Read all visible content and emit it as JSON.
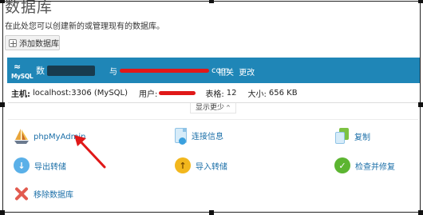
{
  "page": {
    "title": "数据库",
    "description": "在此处您可以创建新的或管理现有的数据库。"
  },
  "toolbar": {
    "add_label": "添加数据库"
  },
  "database": {
    "server_type": "MySQL",
    "name_prefix": "数",
    "user_prefix": "与",
    "user_suffix": "com",
    "links": [
      "相关",
      "更改"
    ],
    "host_label": "主机:",
    "host_value": "localhost:3306 (MySQL)",
    "user_label": "用户:",
    "tables_label": "表格:",
    "tables_value": "12",
    "size_label": "大小:",
    "size_value": "656 KB"
  },
  "toggle": {
    "label": "显示更少"
  },
  "tools": {
    "phpmyadmin": "phpMyAdmin",
    "connection_info": "连接信息",
    "copy": "复制",
    "export_dump": "导出转储",
    "import_dump": "导入转储",
    "check_repair": "检查并修复",
    "remove_db": "移除数据库"
  },
  "colors": {
    "header_bar": "#1f86b7",
    "link": "#1b6fa8",
    "annotation": "#e01818"
  }
}
